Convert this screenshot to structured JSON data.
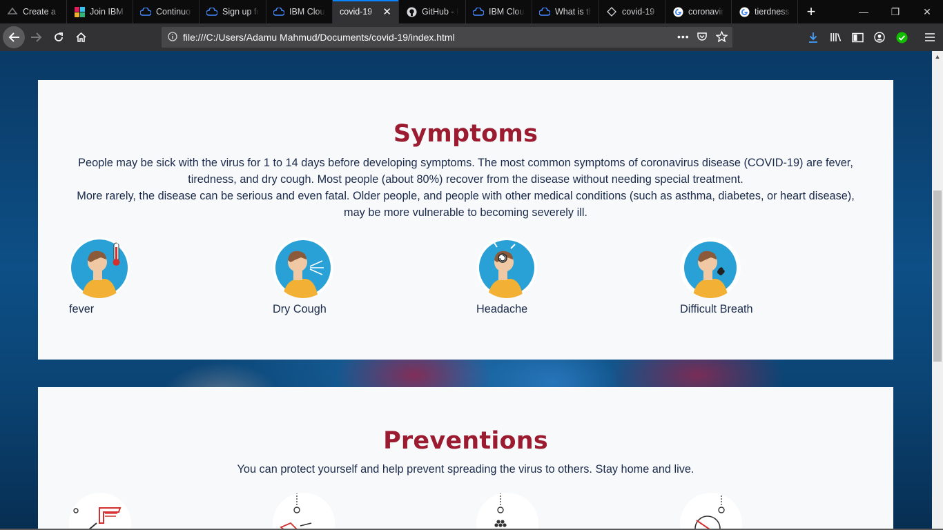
{
  "tabs": [
    {
      "label": "Create a q",
      "icon": "ibm-cloud-icon"
    },
    {
      "label": "Join IBM C",
      "icon": "slack-icon"
    },
    {
      "label": "Continuo",
      "icon": "ibm-cloud-icon"
    },
    {
      "label": "Sign up fo",
      "icon": "ibm-cloud-icon"
    },
    {
      "label": "IBM Cloud",
      "icon": "ibm-cloud-icon"
    },
    {
      "label": "covid-19",
      "icon": "",
      "active": true
    },
    {
      "label": "GitHub - I",
      "icon": "github-icon"
    },
    {
      "label": "IBM Cloud",
      "icon": "ibm-cloud-icon"
    },
    {
      "label": "What is th",
      "icon": "ibm-cloud-icon"
    },
    {
      "label": "covid-19",
      "icon": "codepen-icon"
    },
    {
      "label": "coronavir",
      "icon": "google-icon"
    },
    {
      "label": "tierdness",
      "icon": "google-icon"
    }
  ],
  "url": "file:///C:/Users/Adamu Mahmud/Documents/covid-19/index.html",
  "page": {
    "symptoms": {
      "title": "Symptoms",
      "para1": "People may be sick with the virus for 1 to 14 days before developing symptoms. The most common symptoms of coronavirus disease (COVID-19) are fever, tiredness, and dry cough. Most people (about 80%) recover from the disease without needing special treatment.",
      "para2": "More rarely, the disease can be serious and even fatal. Older people, and people with other medical conditions (such as asthma, diabetes, or heart disease), may be more vulnerable to becoming severely ill.",
      "items": [
        {
          "label": "fever"
        },
        {
          "label": "Dry Cough"
        },
        {
          "label": "Headache"
        },
        {
          "label": "Difficult Breath"
        }
      ]
    },
    "preventions": {
      "title": "Preventions",
      "text": "You can protect yourself and help prevent spreading the virus to others. Stay home and live."
    }
  },
  "colors": {
    "heading": "#9b1b30",
    "body_text": "#1a2a4a",
    "icon_circle": "#2aa1d6",
    "accent_blue": "#0a84ff",
    "check_green": "#12bc00"
  }
}
